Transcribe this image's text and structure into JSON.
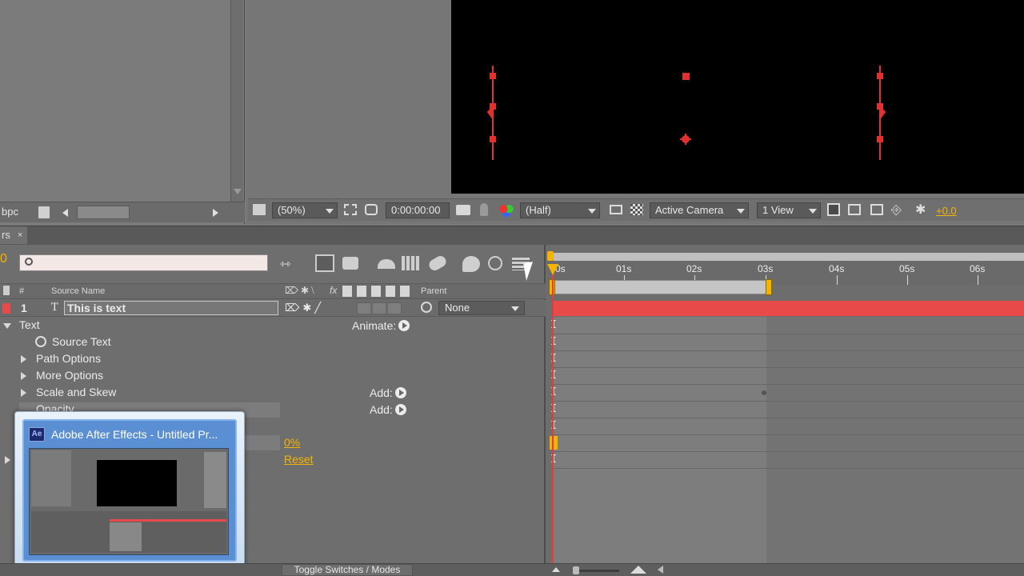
{
  "project_panel": {
    "bpc_label": "bpc"
  },
  "viewer": {
    "zoom": "(50%)",
    "timecode": "0:00:00:00",
    "resolution": "(Half)",
    "camera": "Active Camera",
    "views": "1 View",
    "exposure": "+0.0"
  },
  "timeline": {
    "tab_label": "rs",
    "search_placeholder": "",
    "columns": {
      "num": "#",
      "source_name": "Source Name",
      "parent": "Parent"
    },
    "layer": {
      "number": "1",
      "name": "This is text",
      "parent": "None"
    },
    "properties": [
      {
        "label": "Text",
        "expanded": true
      },
      {
        "label": "Source Text"
      },
      {
        "label": "Path Options"
      },
      {
        "label": "More Options"
      },
      {
        "label": "Scale and Skew"
      },
      {
        "label": "Opacity"
      }
    ],
    "animate_label": "Animate:",
    "add_label_1": "Add:",
    "add_label_2": "Add:",
    "percent_value": "0%",
    "reset_label": "Reset",
    "ruler_ticks": [
      "0s",
      "01s",
      "02s",
      "03s",
      "04s",
      "05s",
      "06s"
    ],
    "toggle_label": "Toggle Switches / Modes"
  },
  "taskbar_preview": {
    "app_icon": "Ae",
    "title": "Adobe After Effects - Untitled Pr..."
  },
  "colors": {
    "layer_bar": "#e84a4a",
    "accent_yellow": "#f5b400",
    "playhead": "#e63b3b"
  }
}
